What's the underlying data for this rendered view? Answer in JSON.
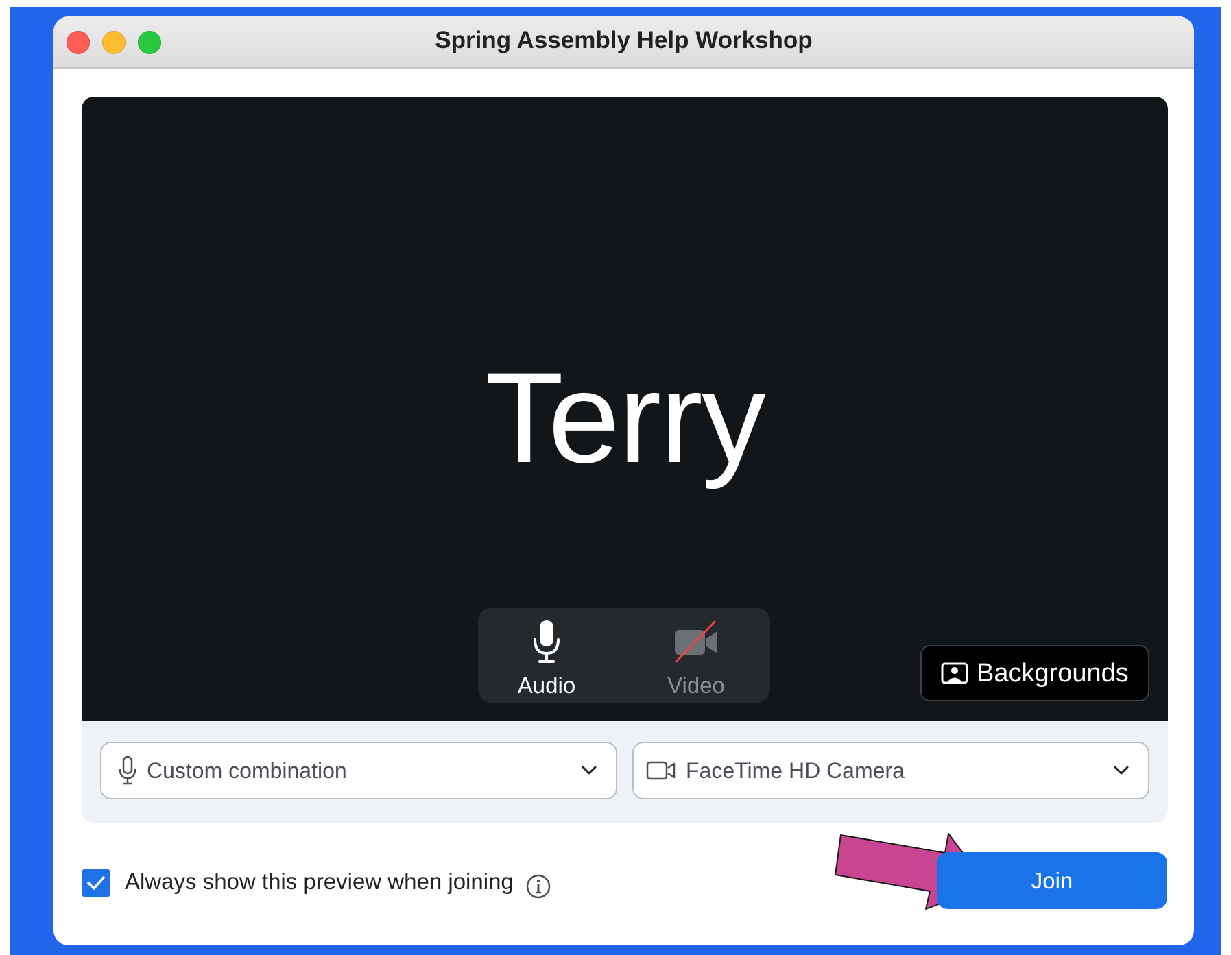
{
  "window": {
    "title": "Spring Assembly Help Workshop"
  },
  "preview": {
    "participant_name": "Terry",
    "audio_label": "Audio",
    "video_label": "Video",
    "video_muted": true,
    "backgrounds_label": "Backgrounds"
  },
  "devices": {
    "microphone": "Custom combination",
    "camera": "FaceTime HD Camera"
  },
  "footer": {
    "always_show_preview_label": "Always show this preview when joining",
    "always_show_preview_checked": true,
    "join_label": "Join"
  },
  "icons": {
    "mic": "microphone-icon",
    "video_off": "video-off-icon",
    "backgrounds": "person-portrait-icon",
    "chevron": "chevron-down-icon",
    "camera": "camera-icon",
    "check": "checkmark-icon",
    "info": "info-icon",
    "annotation": "arrow-right-icon"
  },
  "colors": {
    "desktop": "#2165ea",
    "accent": "#1a73e8",
    "preview_bg": "#131619",
    "mute_slash": "#e8473f",
    "annotation_arrow": "#c94592"
  }
}
